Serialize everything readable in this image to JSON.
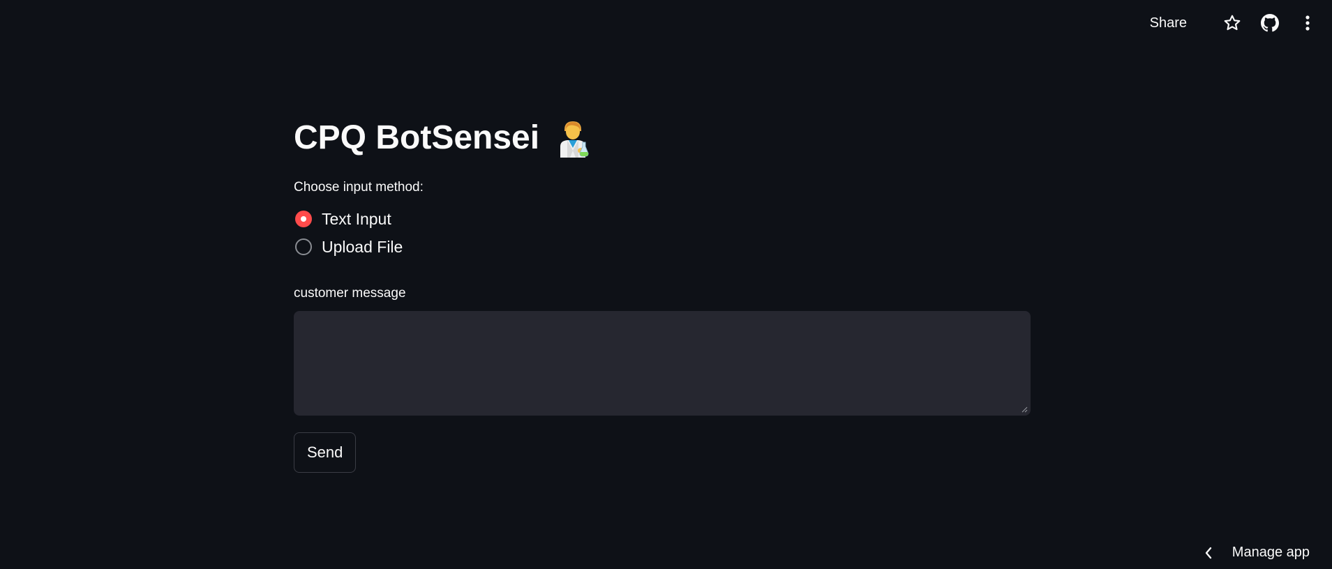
{
  "toolbar": {
    "share_label": "Share",
    "icons": [
      "star-icon",
      "github-icon",
      "more-vertical-icon"
    ]
  },
  "app": {
    "title": "CPQ BotSensei",
    "title_emoji": "scientist-emoji",
    "accent_color": "#ff4b4b",
    "background_color": "#0e1117"
  },
  "input_method": {
    "label": "Choose input method:",
    "options": [
      {
        "label": "Text Input",
        "selected": true
      },
      {
        "label": "Upload File",
        "selected": false
      }
    ]
  },
  "message": {
    "label": "customer message",
    "value": ""
  },
  "send_label": "Send",
  "footer": {
    "manage_label": "Manage app"
  }
}
